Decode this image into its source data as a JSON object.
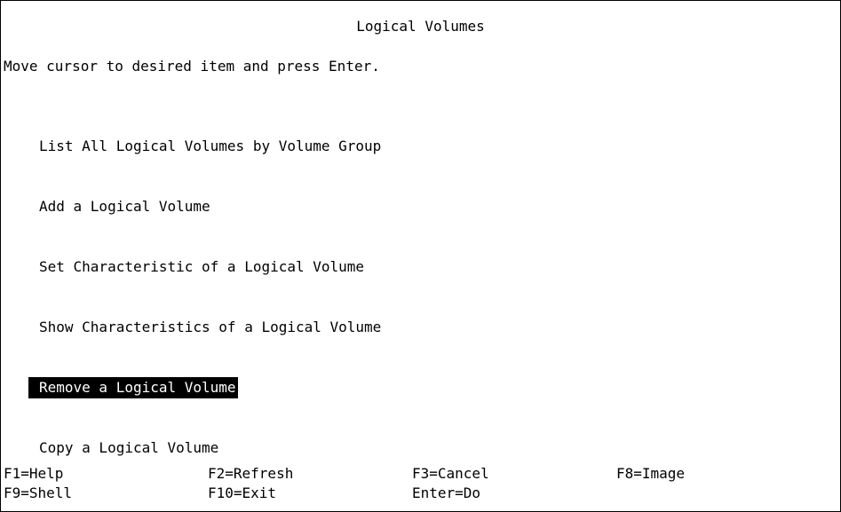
{
  "screen": {
    "title": "Logical Volumes",
    "instructions": "Move cursor to desired item and press Enter."
  },
  "menu": {
    "items": [
      {
        "label": "List All Logical Volumes by Volume Group"
      },
      {
        "label": "Add a Logical Volume"
      },
      {
        "label": "Set Characteristic of a Logical Volume"
      },
      {
        "label": "Show Characteristics of a Logical Volume"
      },
      {
        "label": "Remove a Logical Volume"
      },
      {
        "label": "Copy a Logical Volume"
      }
    ],
    "selected_label": "Remove a Logical Volume"
  },
  "function_keys": {
    "f1": "F1=Help",
    "f2": "F2=Refresh",
    "f3": "F3=Cancel",
    "f8": "F8=Image",
    "f9": "F9=Shell",
    "f10": "F10=Exit",
    "enter": "Enter=Do"
  },
  "colors": {
    "background": "#ffffff",
    "text": "#000000",
    "highlight_background": "#000000",
    "highlight_text": "#ffffff"
  }
}
